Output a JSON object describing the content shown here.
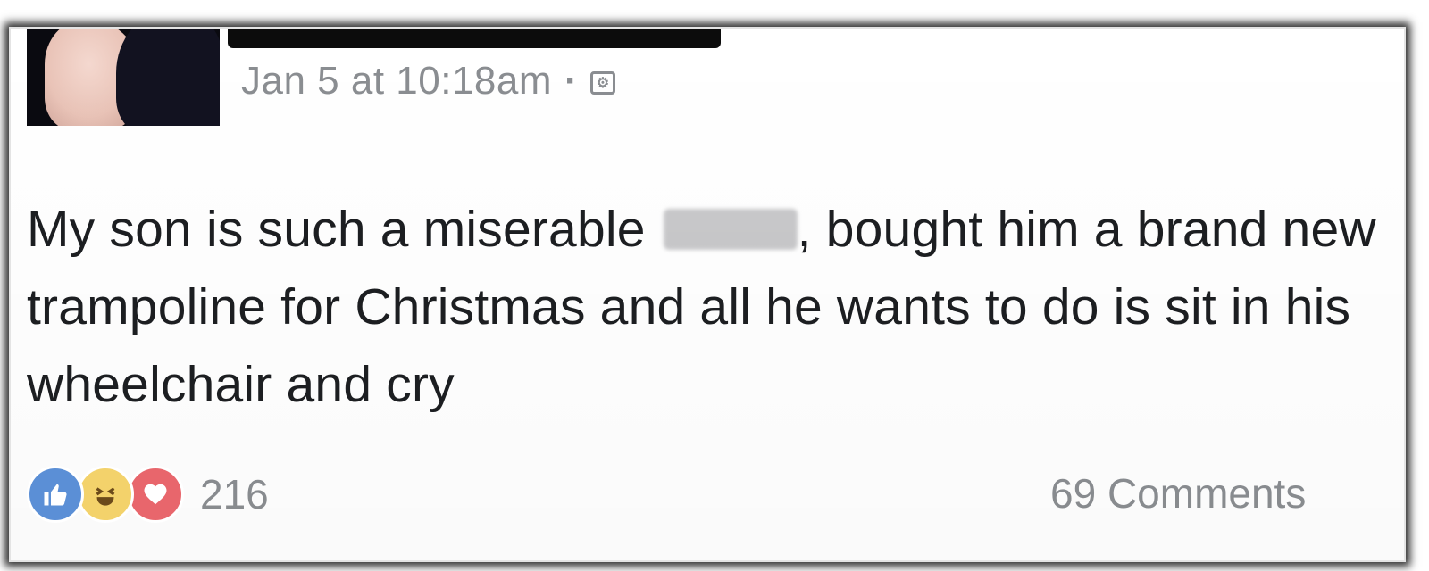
{
  "post": {
    "timestamp": "Jan 5 at 10:18am",
    "separator": "·",
    "privacy_icon": "custom-privacy-icon",
    "text_before_censor": "My son is such a miserable",
    "text_after_censor": ", bought him a brand new trampoline for Christmas and all he wants to do is sit in his wheelchair and cry"
  },
  "reactions": {
    "icons": [
      "like-icon",
      "haha-icon",
      "love-icon"
    ],
    "count": "216"
  },
  "comments": {
    "label": "69 Comments"
  },
  "colors": {
    "meta_gray": "#8a8d91",
    "text": "#1c1e21",
    "like_blue": "#5b8fd6",
    "haha_yellow": "#f3d26b",
    "love_red": "#e8666c"
  }
}
